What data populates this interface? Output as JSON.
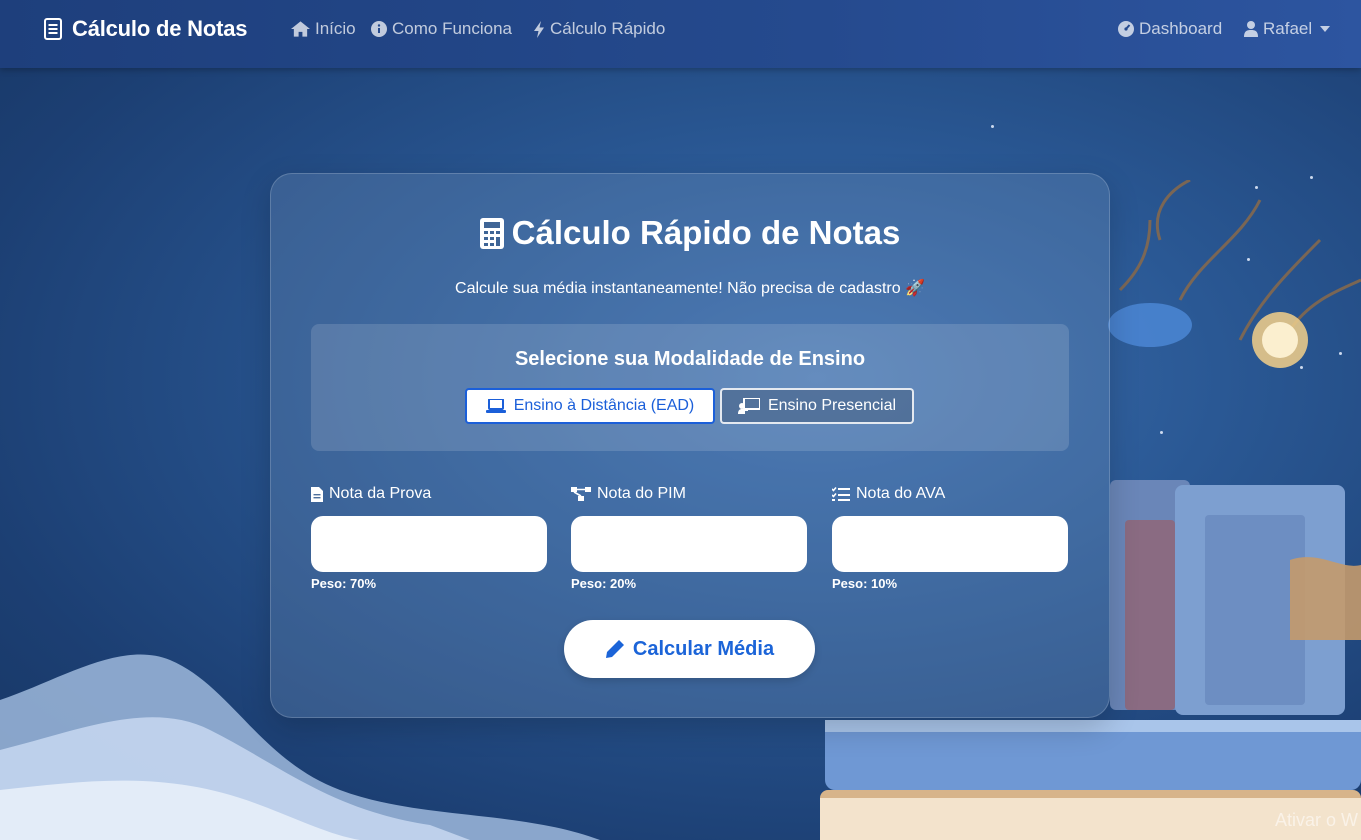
{
  "navbar": {
    "brand": "Cálculo de Notas",
    "links": [
      {
        "label": "Início",
        "icon": "home-icon"
      },
      {
        "label": "Como Funciona",
        "icon": "info-icon"
      },
      {
        "label": "Cálculo Rápido",
        "icon": "bolt-icon"
      }
    ],
    "dashboard": "Dashboard",
    "user": "Rafael"
  },
  "card": {
    "title": "Cálculo Rápido de Notas",
    "subtitle": "Calcule sua média instantaneamente! Não precisa de cadastro 🚀",
    "mode": {
      "title": "Selecione sua Modalidade de Ensino",
      "ead_label": "Ensino à Distância (EAD)",
      "presencial_label": "Ensino Presencial",
      "selected": "Ensino à Distância (EAD)"
    },
    "fields": [
      {
        "label": "Nota da Prova",
        "value": "",
        "weight": "Peso: 70%",
        "icon": "file-icon"
      },
      {
        "label": "Nota do PIM",
        "value": "",
        "weight": "Peso: 20%",
        "icon": "project-diagram-icon"
      },
      {
        "label": "Nota do AVA",
        "value": "",
        "weight": "Peso: 10%",
        "icon": "task-list-icon"
      }
    ],
    "calculate_label": "Calcular Média"
  },
  "watermark": "Ativar o W",
  "colors": {
    "navbar": "#254a8e",
    "accent": "#1b64d8",
    "background": "#2a5894"
  }
}
